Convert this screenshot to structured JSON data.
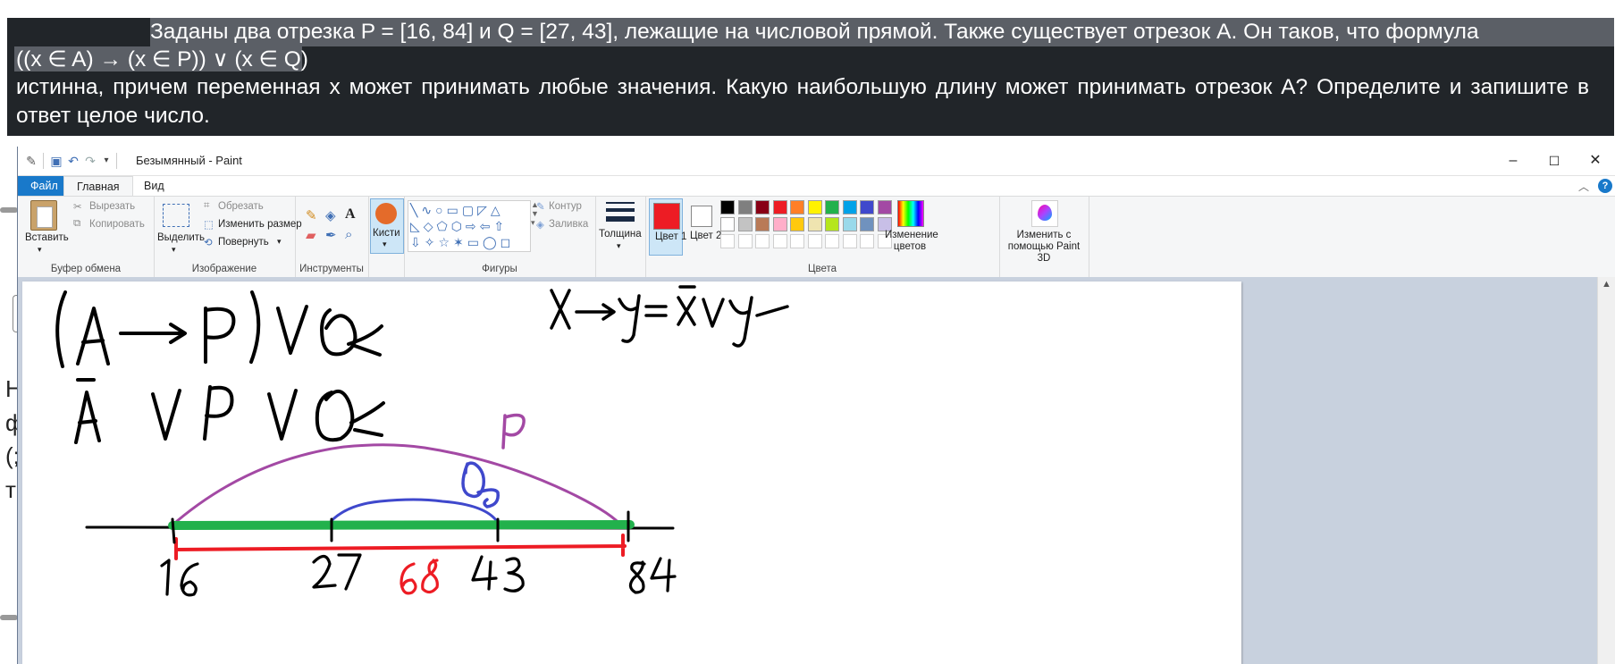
{
  "question": {
    "line1": "Заданы два отрезка P = [16, 84] и Q = [27, 43], лежащие на числовой прямой. Также существует отрезок A. Он таков, что формула",
    "line2": "((x ∈ A) → (x ∈ P)) ∨ (x ∈ Q)",
    "line3": "истинна, причем переменная x может принимать любые значения. Какую наибольшую длину может принимать отрезок A? Определите и запишите в ответ целое число."
  },
  "background_fragments": [
    "Н",
    "ф",
    "(;",
    "т"
  ],
  "window": {
    "title": "Безымянный - Paint",
    "tabs": [
      "Файл",
      "Главная",
      "Вид"
    ]
  },
  "ribbon": {
    "clipboard": {
      "paste": "Вставить",
      "cut": "Вырезать",
      "copy": "Копировать",
      "label": "Буфер обмена"
    },
    "image": {
      "select": "Выделить",
      "crop": "Обрезать",
      "resize": "Изменить размер",
      "rotate": "Повернуть",
      "label": "Изображение"
    },
    "tools": {
      "label": "Инструменты"
    },
    "brushes": {
      "label": "Кисти"
    },
    "shapes": {
      "outline": "Контур",
      "fill": "Заливка",
      "label": "Фигуры"
    },
    "size": {
      "label": "Толщина"
    },
    "color1": {
      "label": "Цвет 1",
      "value": "#ed1c24"
    },
    "color2": {
      "label": "Цвет 2",
      "value": "#ffffff"
    },
    "colors": {
      "label": "Цвета",
      "edit": "Изменение цветов"
    },
    "paint3d": {
      "label": "Изменить с помощью Paint 3D"
    },
    "palette_row1": [
      "#000000",
      "#7f7f7f",
      "#880015",
      "#ed1c24",
      "#ff7f27",
      "#fff200",
      "#22b14c",
      "#00a2e8",
      "#3f48cc",
      "#a349a4"
    ],
    "palette_row2": [
      "#ffffff",
      "#c3c3c3",
      "#b97a57",
      "#ffaec9",
      "#ffc90e",
      "#efe4b0",
      "#b5e61d",
      "#99d9ea",
      "#7092be",
      "#c8bfe7"
    ]
  },
  "drawing": {
    "formula1": "(A → P) ∨ Q",
    "formula2": "Ā ∨ P ∨ Q",
    "identity": "x → y = x̄ ∨ y",
    "label_p": "P",
    "label_q": "Q",
    "ticks": [
      "16",
      "27",
      "43",
      "84"
    ],
    "answer": "68",
    "colors": {
      "ink": "#000000",
      "p_arc": "#a349a4",
      "q_arc": "#3f48cc",
      "green_band": "#22b14c",
      "red_band": "#ed1c24"
    }
  }
}
